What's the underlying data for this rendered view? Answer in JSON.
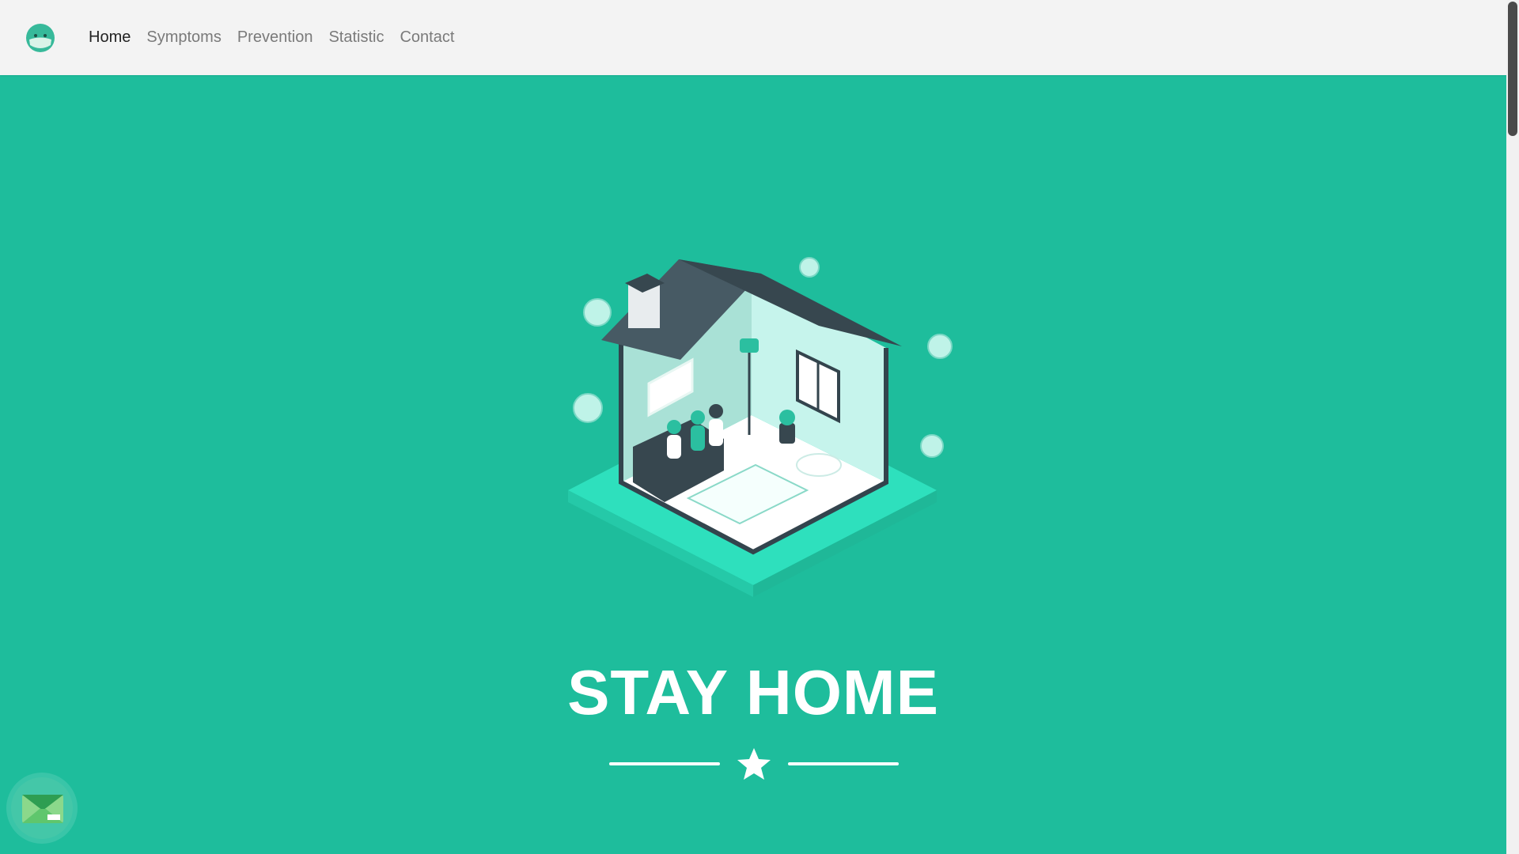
{
  "brand": {
    "logo_icon": "mask-face-icon"
  },
  "nav": {
    "items": [
      {
        "label": "Home",
        "active": true
      },
      {
        "label": "Symptoms",
        "active": false
      },
      {
        "label": "Prevention",
        "active": false
      },
      {
        "label": "Statistic",
        "active": false
      },
      {
        "label": "Contact",
        "active": false
      }
    ]
  },
  "hero": {
    "title": "STAY HOME",
    "illustration": "family-in-house-illustration",
    "divider_icon": "star-icon"
  },
  "fab": {
    "icon": "mail-envelope-icon"
  },
  "colors": {
    "background": "#1ebd9c",
    "navbar": "#f3f3f3",
    "text_white": "#ffffff"
  }
}
